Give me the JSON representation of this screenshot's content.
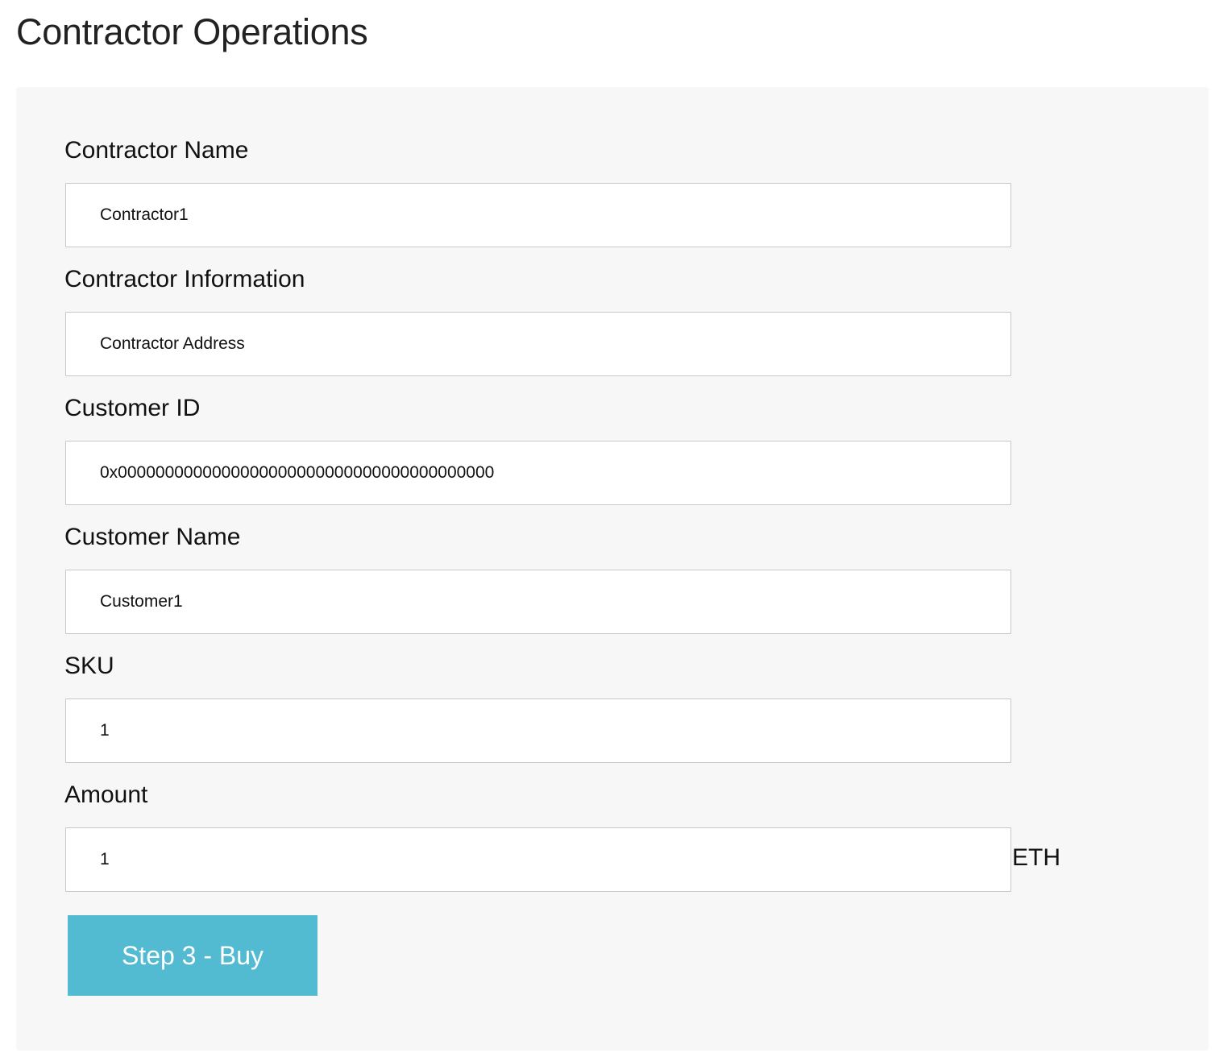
{
  "page": {
    "title": "Contractor Operations"
  },
  "form": {
    "contractor_name": {
      "label": "Contractor Name",
      "value": "Contractor1"
    },
    "contractor_information": {
      "label": "Contractor Information",
      "value": "Contractor Address"
    },
    "customer_id": {
      "label": "Customer ID",
      "value": "0x0000000000000000000000000000000000000000"
    },
    "customer_name": {
      "label": "Customer Name",
      "value": "Customer1"
    },
    "sku": {
      "label": "SKU",
      "value": "1"
    },
    "amount": {
      "label": "Amount",
      "value": "1",
      "unit": "ETH"
    },
    "submit_label": "Step 3 - Buy"
  },
  "colors": {
    "panel_background": "#f7f7f7",
    "button_accent": "#52bbd2",
    "input_border": "#c8c8c8"
  }
}
